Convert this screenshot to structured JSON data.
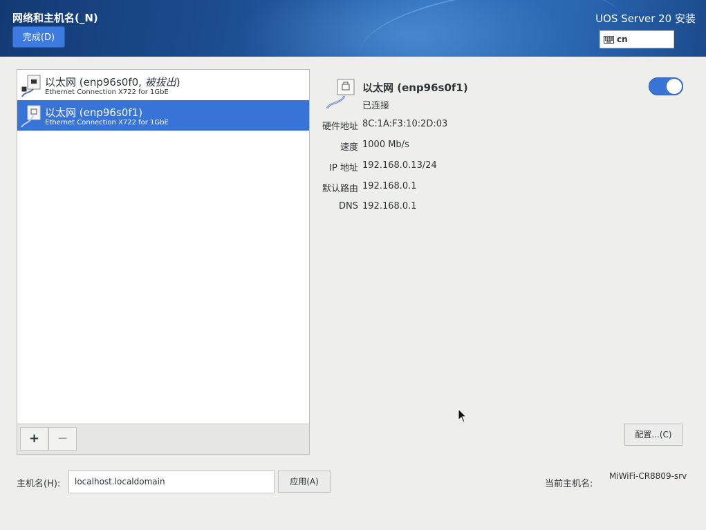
{
  "header": {
    "title": "网络和主机名(_N)",
    "done_label": "完成(D)",
    "product": "UOS Server 20 安装",
    "keyboard_layout": "cn"
  },
  "devices": [
    {
      "name": "以太网 (enp96s0f0, ",
      "name_status": "被拔出",
      "name_tail": ")",
      "subtitle": "Ethernet Connection X722 for 1GbE",
      "selected": false
    },
    {
      "name": "以太网 (enp96s0f1)",
      "subtitle": "Ethernet Connection X722 for 1GbE",
      "selected": true
    }
  ],
  "list_toolbar": {
    "add": "+",
    "remove": "−"
  },
  "detail": {
    "name": "以太网 (enp96s0f1)",
    "status": "已连接",
    "enabled": true,
    "fields": [
      {
        "label": "硬件地址",
        "value": "8C:1A:F3:10:2D:03"
      },
      {
        "label": "速度",
        "value": "1000 Mb/s"
      },
      {
        "label": "IP 地址",
        "value": "192.168.0.13/24"
      },
      {
        "label": "默认路由",
        "value": "192.168.0.1"
      },
      {
        "label": "DNS",
        "value": "192.168.0.1"
      }
    ],
    "configure_label": "配置...(C)"
  },
  "hostname": {
    "label": "主机名(H):",
    "value": "localhost.localdomain",
    "apply_label": "应用(A)",
    "current_label": "当前主机名:",
    "current_value": "MiWiFi-CR8809-srv"
  },
  "colors": {
    "accent": "#3874d8",
    "header_dark": "#133a73"
  }
}
